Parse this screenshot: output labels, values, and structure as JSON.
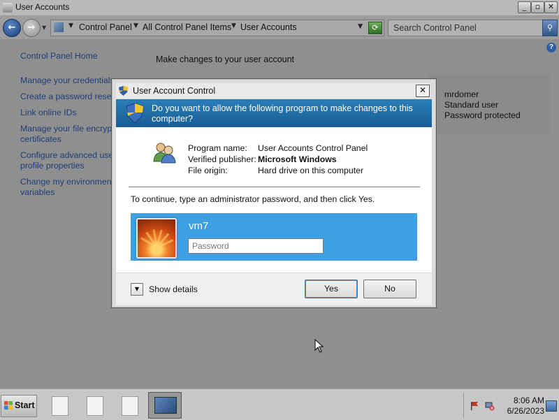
{
  "window": {
    "title": "User Accounts",
    "controls": {
      "minimize": "_",
      "maximize": "▫",
      "close": "✕"
    }
  },
  "address": {
    "crumbs": [
      "Control Panel",
      "All Control Panel Items",
      "User Accounts"
    ],
    "search_placeholder": "Search Control Panel"
  },
  "sidebar": {
    "items": [
      {
        "label": "Control Panel Home"
      },
      {
        "label": "Manage your credentials"
      },
      {
        "label": "Create a password reset disk"
      },
      {
        "label": "Link online IDs"
      },
      {
        "label": "Manage your file encryption certificates"
      },
      {
        "label": "Configure advanced user profile properties"
      },
      {
        "label": "Change my environment variables"
      }
    ],
    "item4_line1": "Manage your file encryption",
    "item4_line2": "certificates",
    "item5_line1": "Configure advanced user",
    "item5_line2": "profile properties",
    "item6_line1": "Change my environment",
    "item6_line2": "variables"
  },
  "main": {
    "heading": "Make changes to your user account"
  },
  "account": {
    "name": "mrdomer",
    "type": "Standard user",
    "status": "Password protected"
  },
  "uac": {
    "title": "User Account Control",
    "question": "Do you want to allow the following program to make changes to this computer?",
    "fields": {
      "program_label": "Program name:",
      "program_value": "User Accounts Control Panel",
      "publisher_label": "Verified publisher:",
      "publisher_value": "Microsoft Windows",
      "origin_label": "File origin:",
      "origin_value": "Hard drive on this computer"
    },
    "instruction": "To continue, type an administrator password, and then click Yes.",
    "credential": {
      "username": "vm7",
      "password_placeholder": "Password",
      "password_value": ""
    },
    "show_details": "Show details",
    "yes_label": "Yes",
    "no_label": "No"
  },
  "taskbar": {
    "start_label": "Start",
    "time": "8:06 AM",
    "date": "6/26/2023"
  },
  "colors": {
    "uac_banner": "#1f6fa8",
    "credential_tile": "#3e9fe4",
    "link": "#1e3f77"
  }
}
